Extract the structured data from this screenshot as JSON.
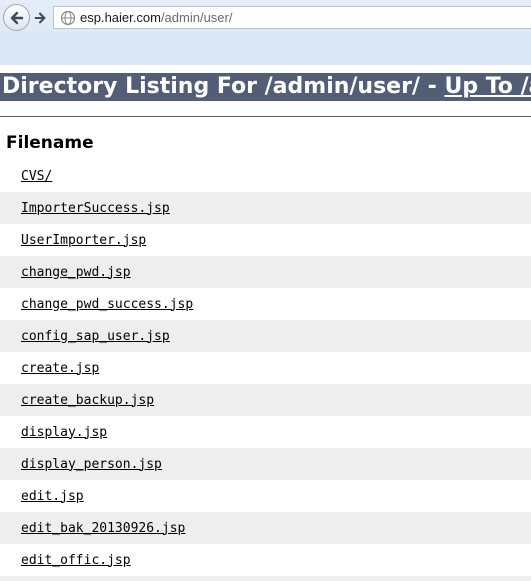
{
  "browser": {
    "url_host": "esp.haier.com",
    "url_path": "/admin/user/",
    "back_icon": "back-arrow-icon",
    "forward_icon": "forward-arrow-icon",
    "site_icon": "globe-icon"
  },
  "page": {
    "heading_prefix": "Directory Listing For /admin/user/ - ",
    "heading_uplink": "Up To /adm",
    "column_header": "Filename",
    "files": [
      "CVS/",
      "ImporterSuccess.jsp",
      "UserImporter.jsp",
      "change_pwd.jsp",
      "change_pwd_success.jsp",
      "config_sap_user.jsp",
      "create.jsp",
      "create_backup.jsp",
      "display.jsp",
      "display_person.jsp",
      "edit.jsp",
      "edit_bak_20130926.jsp",
      "edit_offic.jsp"
    ]
  },
  "colors": {
    "heading_bg": "#525d76",
    "row_alt_bg": "#eeeeee",
    "chrome_bg": "#dde8f6"
  }
}
